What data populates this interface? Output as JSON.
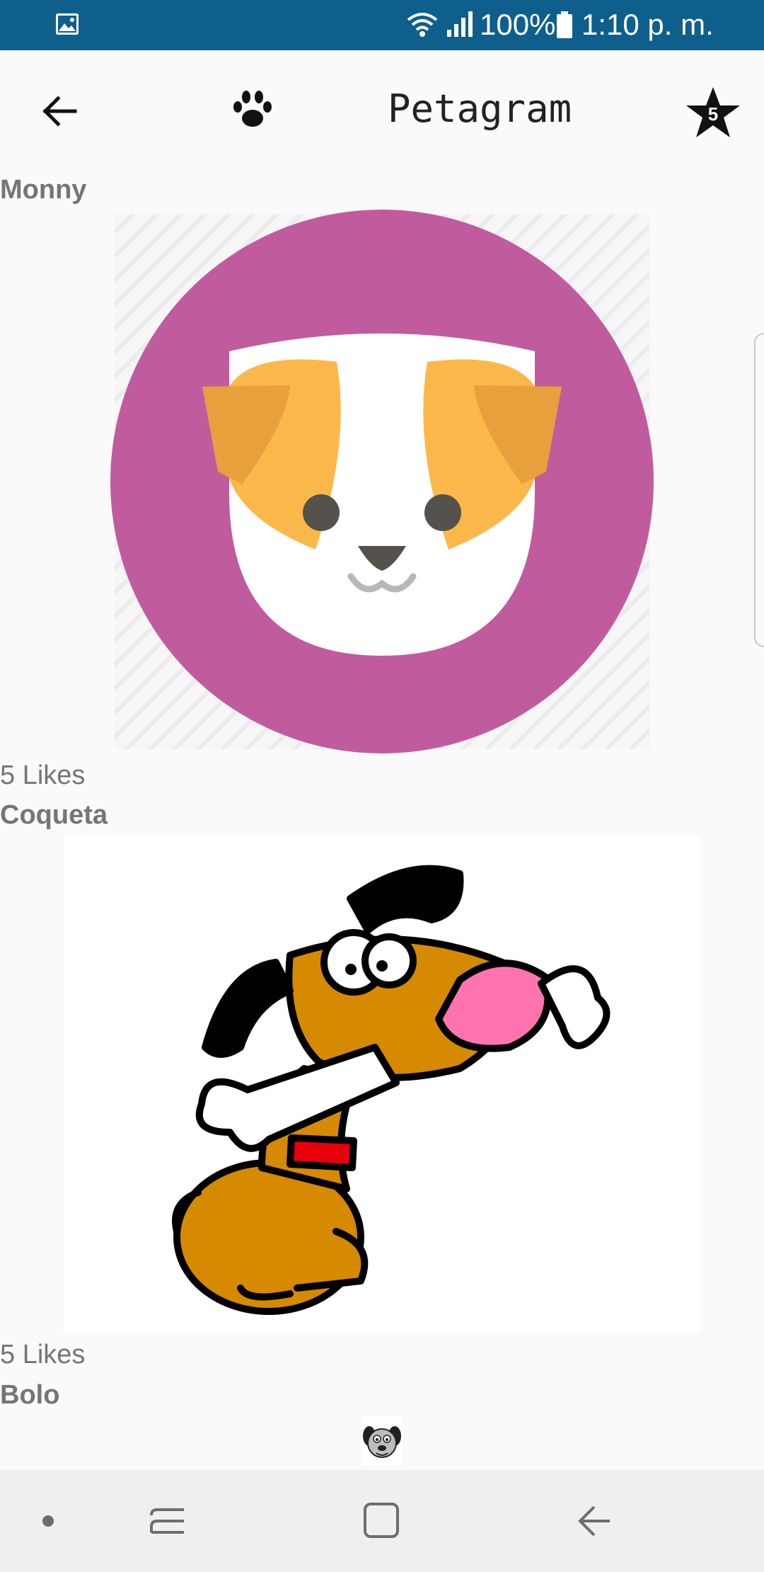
{
  "status_bar": {
    "battery_text": "100%",
    "time": "1:10 p. m.",
    "icons": [
      "image-icon",
      "wifi-icon",
      "signal-icon",
      "battery-icon"
    ]
  },
  "toolbar": {
    "title": "Petagram",
    "back_icon": "arrow-back-icon",
    "logo_icon": "paw-icon",
    "favorites_icon": "star-icon",
    "favorites_count": "5"
  },
  "pets": [
    {
      "name": "Monny",
      "likes": "5 Likes",
      "image": "dog-face-purple-circle"
    },
    {
      "name": "Coqueta",
      "likes": "5 Likes",
      "image": "cartoon-dog-with-bone"
    },
    {
      "name": "Bolo",
      "image": "small-cartoon-dog-face"
    }
  ],
  "nav_bar": {
    "icons": [
      "dot-icon",
      "recent-apps-icon",
      "home-icon",
      "back-icon"
    ]
  },
  "colors": {
    "status_bar": "#0e5f8c",
    "text_secondary": "#757575",
    "pet_circle": "#c05c9e",
    "dog_orange": "#fbb84a",
    "dog_ear": "#e8a03d"
  }
}
